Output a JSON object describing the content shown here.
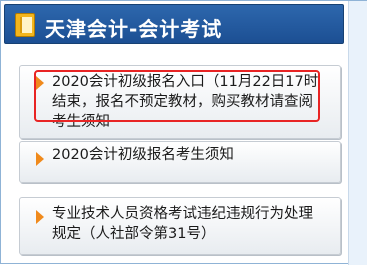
{
  "header": {
    "title": "天津会计-会计考试",
    "icon": "book-icon"
  },
  "list": {
    "items": [
      {
        "text": "2020会计初级报名入口（11月22日17时结束，报名不预定教材，购买教材请查阅考生须知",
        "highlighted": true
      },
      {
        "text": "2020会计初级报名考生须知",
        "highlighted": false
      },
      {
        "text": "专业技术人员资格考试违纪违规行为处理规定（人社部令第31号）",
        "highlighted": false
      }
    ]
  },
  "colors": {
    "header_bg": "#2d67ad",
    "arrow": "#f08a1c",
    "highlight_border": "#e82424"
  }
}
